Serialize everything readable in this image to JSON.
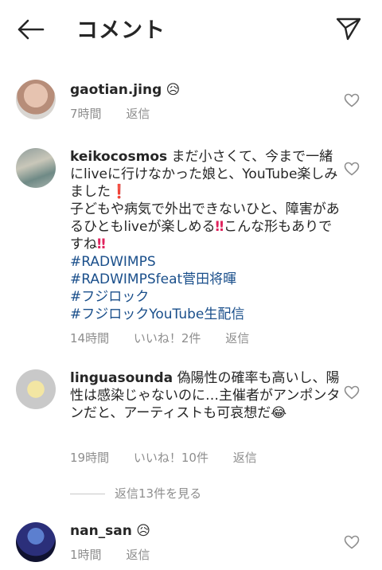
{
  "header": {
    "title": "コメント"
  },
  "comments": [
    {
      "username": "gaotian.jing",
      "emoji": "😥",
      "time": "7時間",
      "reply": "返信"
    },
    {
      "username": "keikocosmos",
      "text1": "まだ小さくて、今まで一緒にliveに行けなかった娘と、YouTube楽しみました",
      "bang1": "❗",
      "text2": "子どもや病気で外出できないひと、障害があるひともliveが楽しめる",
      "bang2": "‼",
      "text3": "こんな形もありですね",
      "bang3": "‼",
      "hashtags": [
        "#RADWIMPS",
        "#RADWIMPSfeat菅田将暉",
        "#フジロック",
        "#フジロックYouTube生配信"
      ],
      "time": "14時間",
      "likes": "いいね！2件",
      "reply": "返信"
    },
    {
      "username": "linguasounda",
      "text": "偽陽性の確率も高いし、陽性は感染じゃないのに…主催者がアンポンタンだと、アーティストも可哀想だ",
      "emoji": "😂",
      "time": "19時間",
      "likes": "いいね！10件",
      "reply": "返信",
      "view_replies": "返信13件を見る"
    },
    {
      "username": "nan_san",
      "emoji": "😥",
      "time": "1時間",
      "reply": "返信"
    }
  ]
}
